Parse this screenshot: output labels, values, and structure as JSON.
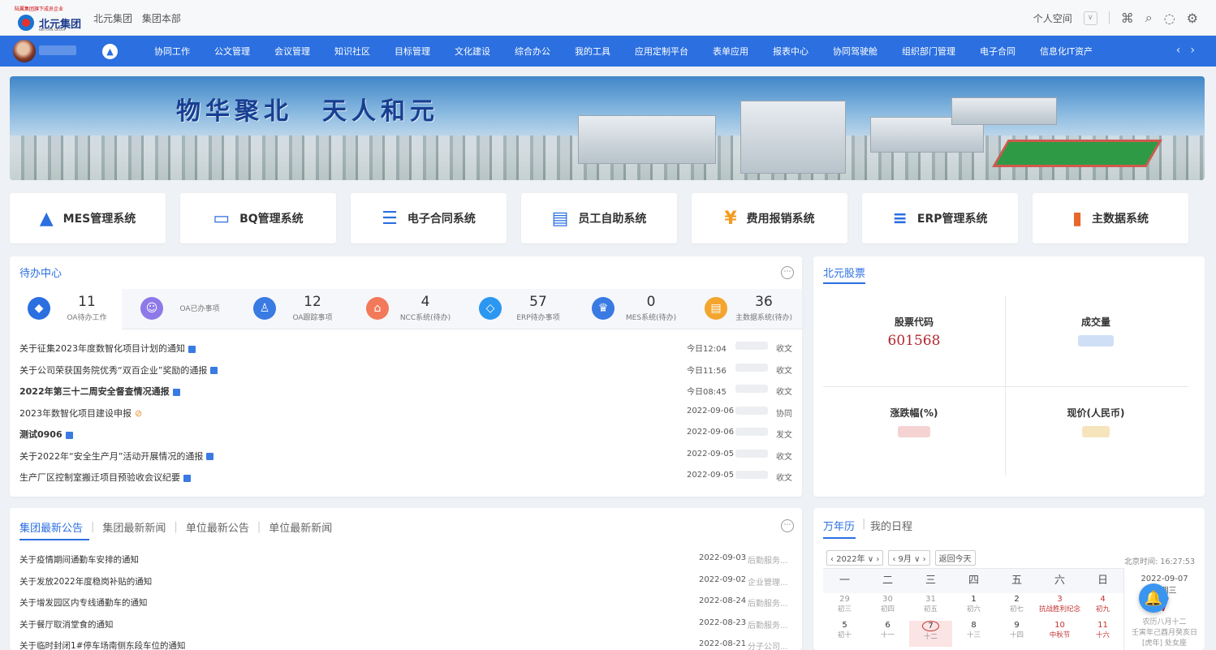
{
  "header": {
    "logo_small_text": "陆翼集团旗下成员企业",
    "logo_name": "北元集团",
    "logo_en": "BEIYUAN GROUP",
    "breadcrumbs": [
      "北元集团",
      "集团本部"
    ],
    "space_label": "个人空间",
    "icons": [
      "apps-icon",
      "search-icon",
      "chat-icon",
      "settings-icon"
    ]
  },
  "nav": {
    "items": [
      "协同工作",
      "公文管理",
      "会议管理",
      "知识社区",
      "目标管理",
      "文化建设",
      "综合办公",
      "我的工具",
      "应用定制平台",
      "表单应用",
      "报表中心",
      "协同驾驶舱",
      "组织部门管理",
      "电子合同",
      "信息化IT资产"
    ]
  },
  "banner": {
    "slogan_part1": "物华聚北",
    "slogan_part2": "天人和元"
  },
  "systems": [
    {
      "label": "MES管理系统",
      "icon": "mes-icon",
      "color": "#2b6fe0"
    },
    {
      "label": "BQ管理系统",
      "icon": "monitor-chart-icon",
      "color": "#2b6fe0"
    },
    {
      "label": "电子合同系统",
      "icon": "document-search-icon",
      "color": "#2b6fe0"
    },
    {
      "label": "员工自助系统",
      "icon": "self-service-icon",
      "color": "#2b6fe0"
    },
    {
      "label": "费用报销系统",
      "icon": "reimburse-icon",
      "color": "#f39a1e"
    },
    {
      "label": "ERP管理系统",
      "icon": "server-icon",
      "color": "#2b6fe0"
    },
    {
      "label": "主数据系统",
      "icon": "bar-chart-icon",
      "color": "#e8672b"
    }
  ],
  "todo_center": {
    "title": "待办中心",
    "stats": [
      {
        "count": "11",
        "label": "OA待办工作",
        "color": "#2b6fe0"
      },
      {
        "count": "",
        "label": "OA已办事项",
        "color": "#8e79e8"
      },
      {
        "count": "12",
        "label": "OA跟踪事项",
        "color": "#3a7ae3"
      },
      {
        "count": "4",
        "label": "NCC系统(待办)",
        "color": "#f27a5b"
      },
      {
        "count": "57",
        "label": "ERP待办事项",
        "color": "#2b97f0"
      },
      {
        "count": "0",
        "label": "MES系统(待办)",
        "color": "#3a7ae3"
      },
      {
        "count": "36",
        "label": "主数据系统(待办)",
        "color": "#f3a52e"
      }
    ],
    "items": [
      {
        "title": "关于征集2023年度数智化项目计划的通知",
        "bold": false,
        "mark": "doc",
        "date": "今日12:04",
        "sender": "",
        "type": "收文"
      },
      {
        "title": "关于公司荣获国务院优秀“双百企业”奖励的通报",
        "bold": false,
        "mark": "doc",
        "date": "今日11:56",
        "sender": "",
        "type": "收文"
      },
      {
        "title": "2022年第三十二周安全督查情况通报",
        "bold": true,
        "mark": "doc",
        "date": "今日08:45",
        "sender": "",
        "type": "收文"
      },
      {
        "title": "2023年数智化项目建设申报",
        "bold": false,
        "mark": "clip",
        "date": "2022-09-06",
        "sender": "",
        "type": "协同"
      },
      {
        "title": "测试0906",
        "bold": true,
        "mark": "doc",
        "date": "2022-09-06",
        "sender": "",
        "type": "发文"
      },
      {
        "title": "关于2022年“安全生产月”活动开展情况的通报",
        "bold": false,
        "mark": "doc",
        "date": "2022-09-05",
        "sender": "",
        "type": "收文"
      },
      {
        "title": "生产厂区控制室搬迁项目预验收会议纪要",
        "bold": false,
        "mark": "doc",
        "date": "2022-09-05",
        "sender": "",
        "type": "收文"
      }
    ]
  },
  "stock": {
    "title": "北元股票",
    "code_label": "股票代码",
    "code_value": "601568",
    "volume_label": "成交量",
    "change_label": "涨跌幅(%)",
    "price_label": "现价(人民币)"
  },
  "news": {
    "tabs": [
      "集团最新公告",
      "集团最新新闻",
      "单位最新公告",
      "单位最新新闻"
    ],
    "items": [
      {
        "title": "关于疫情期间通勤车安排的通知",
        "date": "2022-09-03",
        "dept": "后勤服务..."
      },
      {
        "title": "关于发放2022年度稳岗补贴的通知",
        "date": "2022-09-02",
        "dept": "企业管理..."
      },
      {
        "title": "关于增发园区内专线通勤车的通知",
        "date": "2022-08-24",
        "dept": "后勤服务..."
      },
      {
        "title": "关于餐厅取消堂食的通知",
        "date": "2022-08-23",
        "dept": "后勤服务..."
      },
      {
        "title": "关于临时封闭1#停车场南侧东段车位的通知",
        "date": "2022-08-21",
        "dept": "分子公司..."
      }
    ]
  },
  "calendar": {
    "tabs": [
      "万年历",
      "我的日程"
    ],
    "year": "2022年",
    "month": "9月",
    "today_btn": "返回今天",
    "beijing_time": "北京时间: 16:27:53",
    "weekdays": [
      "一",
      "二",
      "三",
      "四",
      "五",
      "六",
      "日"
    ],
    "rows": [
      [
        {
          "d": "29",
          "l": "初三",
          "m": true
        },
        {
          "d": "30",
          "l": "初四",
          "m": true
        },
        {
          "d": "31",
          "l": "初五",
          "m": true
        },
        {
          "d": "1",
          "l": "初六"
        },
        {
          "d": "2",
          "l": "初七"
        },
        {
          "d": "3",
          "l": "抗战胜利纪念",
          "r": true
        },
        {
          "d": "4",
          "l": "初九",
          "r": true
        }
      ],
      [
        {
          "d": "5",
          "l": "初十"
        },
        {
          "d": "6",
          "l": "十一"
        },
        {
          "d": "7",
          "l": "十二",
          "t": true
        },
        {
          "d": "8",
          "l": "十三"
        },
        {
          "d": "9",
          "l": "十四"
        },
        {
          "d": "10",
          "l": "中秋节",
          "r": true
        },
        {
          "d": "11",
          "l": "十六",
          "r": true
        }
      ]
    ],
    "side_date": "2022-09-07",
    "side_weekday": "星期三",
    "side_day": "7",
    "side_lunar": "农历八月十二",
    "side_ganzhi": "壬寅年己酉月癸亥日",
    "side_extra": "[虎年] 处女座"
  }
}
